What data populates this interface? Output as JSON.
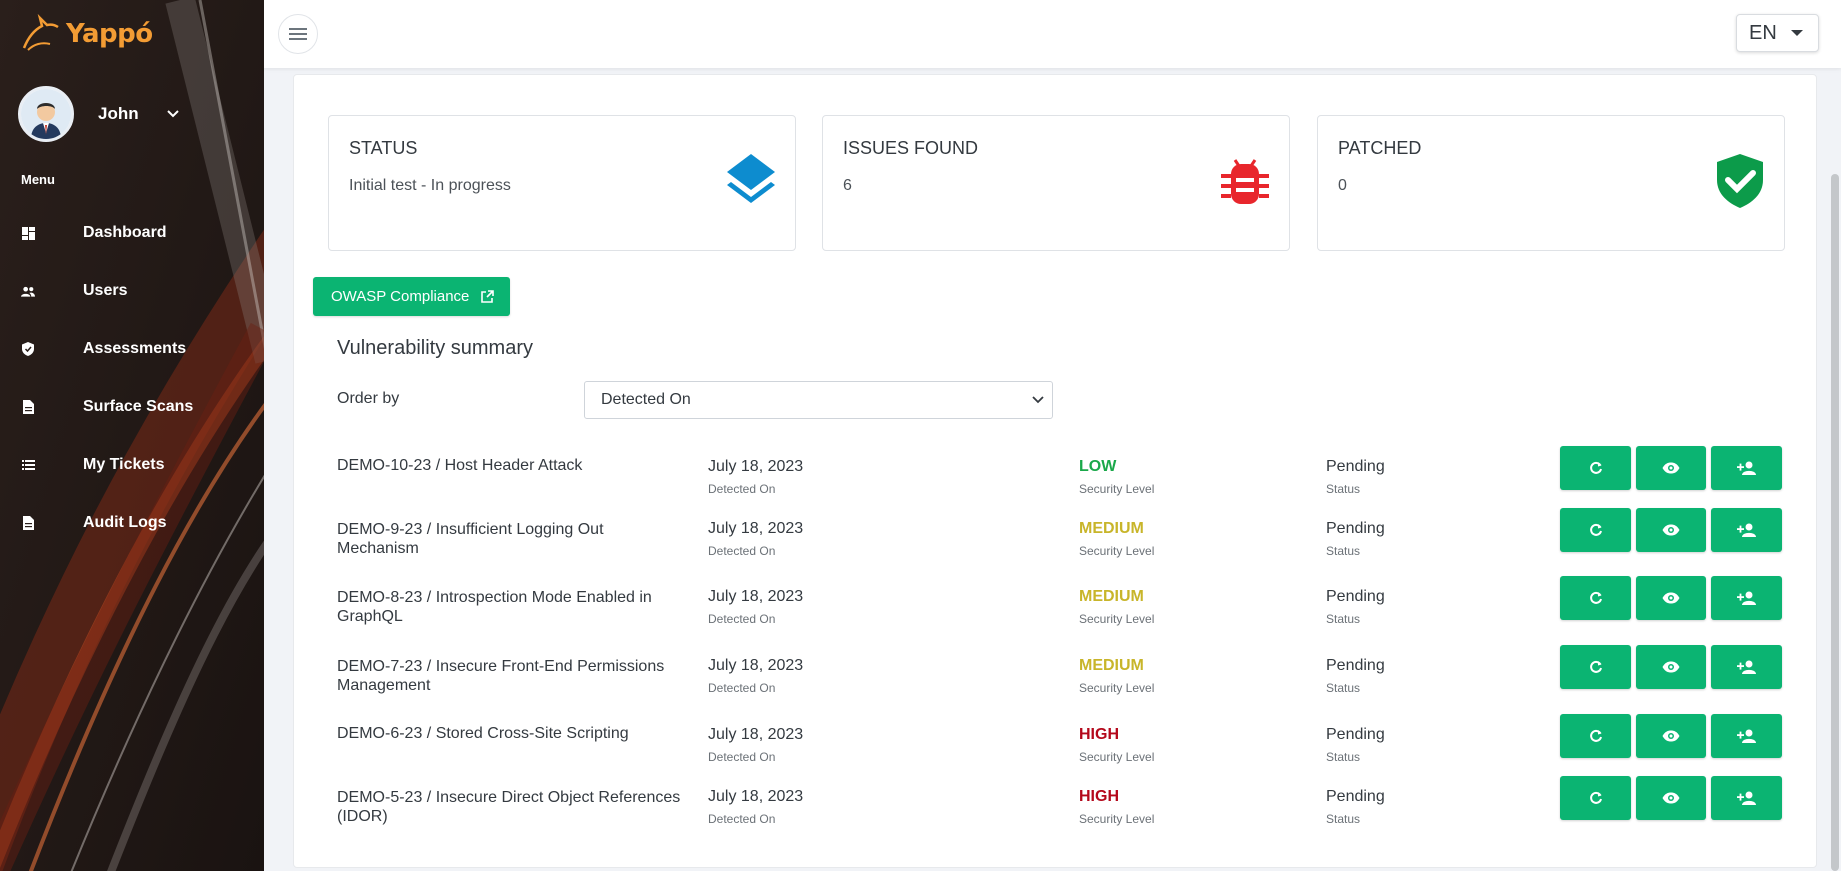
{
  "app": {
    "name": "Yappó"
  },
  "user": {
    "name": "John"
  },
  "sidebar": {
    "menu_title": "Menu",
    "items": [
      {
        "label": "Dashboard",
        "icon": "dashboard-icon"
      },
      {
        "label": "Users",
        "icon": "users-icon"
      },
      {
        "label": "Assessments",
        "icon": "shield-icon"
      },
      {
        "label": "Surface Scans",
        "icon": "document-icon"
      },
      {
        "label": "My Tickets",
        "icon": "list-icon"
      },
      {
        "label": "Audit Logs",
        "icon": "document-icon"
      }
    ]
  },
  "topbar": {
    "language": "EN"
  },
  "stats": [
    {
      "title": "STATUS",
      "value": "Initial test - In progress",
      "icon": "layers-icon",
      "color": "#0d8ccf"
    },
    {
      "title": "ISSUES FOUND",
      "value": "6",
      "icon": "bug-icon",
      "color": "#e8262c"
    },
    {
      "title": "PATCHED",
      "value": "0",
      "icon": "shield-check-icon",
      "color": "#0c9b4a"
    }
  ],
  "owasp_button": "OWASP Compliance",
  "summary": {
    "title": "Vulnerability summary",
    "order_label": "Order by",
    "order_value": "Detected On"
  },
  "colors": {
    "accent": "#0bb472",
    "low": "#1aa84a",
    "medium": "#c8b52a",
    "high": "#b4081b"
  },
  "vulnerabilities": [
    {
      "name": "DEMO-10-23 / Host Header Attack",
      "date": "July 18, 2023",
      "date_label": "Detected On",
      "level": "LOW",
      "level_label": "Security Level",
      "status": "Pending",
      "status_label": "Status"
    },
    {
      "name": "DEMO-9-23 / Insufficient Logging Out Mechanism",
      "date": "July 18, 2023",
      "date_label": "Detected On",
      "level": "MEDIUM",
      "level_label": "Security Level",
      "status": "Pending",
      "status_label": "Status"
    },
    {
      "name": "DEMO-8-23 / Introspection Mode Enabled in GraphQL",
      "date": "July 18, 2023",
      "date_label": "Detected On",
      "level": "MEDIUM",
      "level_label": "Security Level",
      "status": "Pending",
      "status_label": "Status"
    },
    {
      "name": "DEMO-7-23 / Insecure Front-End Permissions Management",
      "date": "July 18, 2023",
      "date_label": "Detected On",
      "level": "MEDIUM",
      "level_label": "Security Level",
      "status": "Pending",
      "status_label": "Status"
    },
    {
      "name": "DEMO-6-23 / Stored Cross-Site Scripting",
      "date": "July 18, 2023",
      "date_label": "Detected On",
      "level": "HIGH",
      "level_label": "Security Level",
      "status": "Pending",
      "status_label": "Status"
    },
    {
      "name": "DEMO-5-23 / Insecure Direct Object References (IDOR)",
      "date": "July 18, 2023",
      "date_label": "Detected On",
      "level": "HIGH",
      "level_label": "Security Level",
      "status": "Pending",
      "status_label": "Status"
    }
  ]
}
